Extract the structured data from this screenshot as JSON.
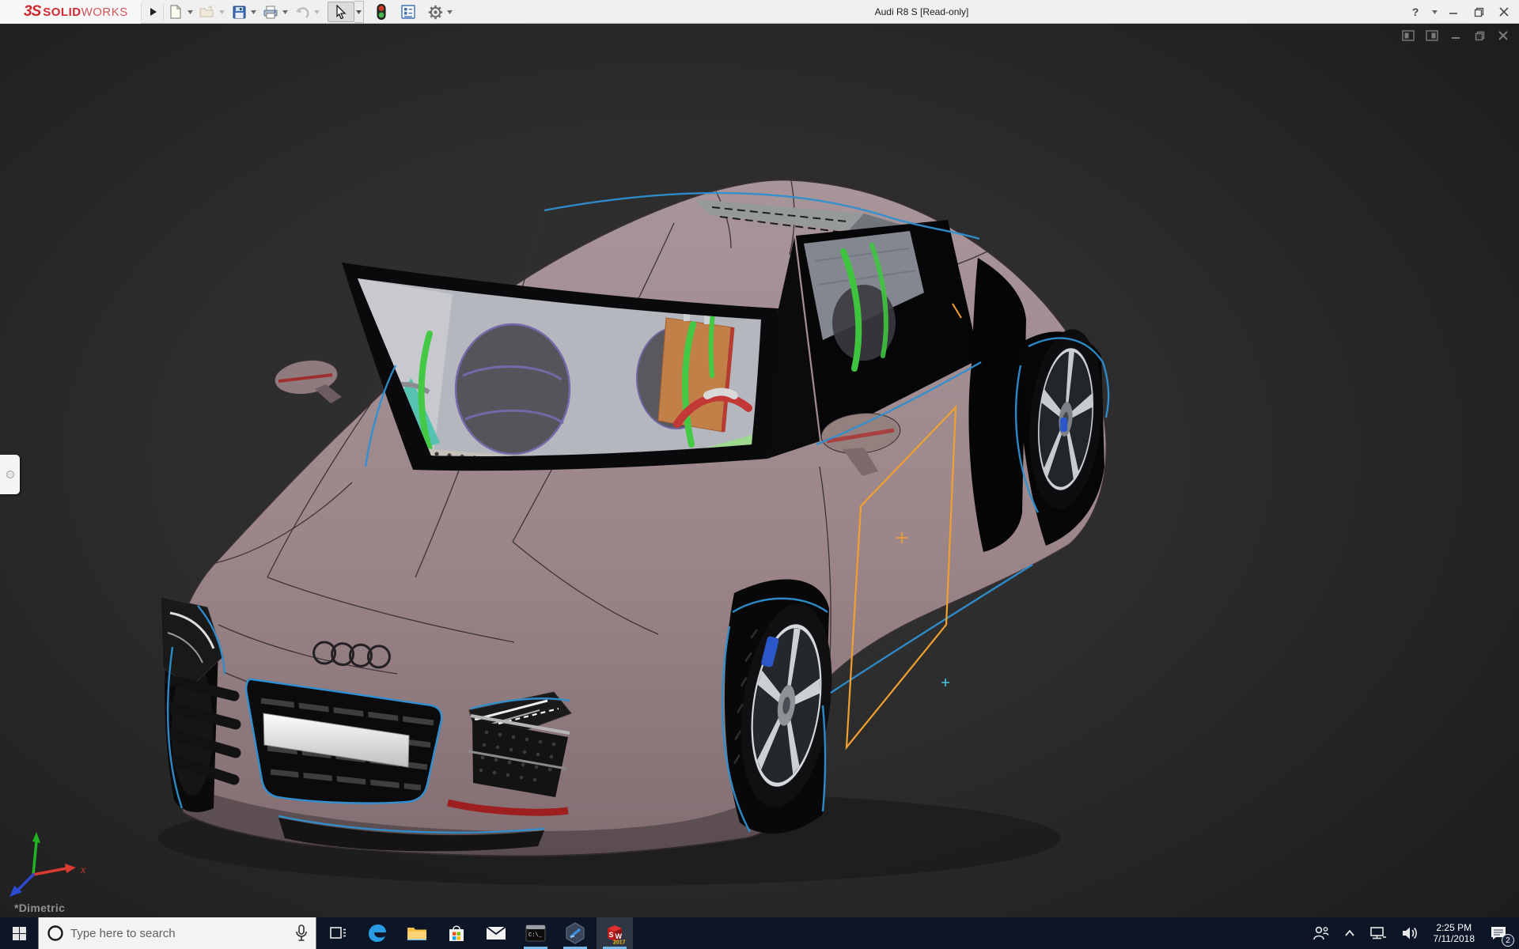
{
  "app": {
    "logo_3s": "3S",
    "logo_solid": "SOLID",
    "logo_works": "WORKS",
    "brand_color": "#cf2a33"
  },
  "titlebar": {
    "title": "Audi R8 S [Read-only]",
    "help_label": "?"
  },
  "toolbar": {
    "buttons": [
      {
        "id": "new",
        "icon": "new-document-icon",
        "dropdown": true,
        "disabled": false
      },
      {
        "id": "open",
        "icon": "open-folder-icon",
        "dropdown": true,
        "disabled": true
      },
      {
        "id": "save",
        "icon": "save-floppy-icon",
        "dropdown": true,
        "disabled": false
      },
      {
        "id": "print",
        "icon": "print-icon",
        "dropdown": true,
        "disabled": false
      },
      {
        "id": "undo",
        "icon": "undo-icon",
        "dropdown": true,
        "disabled": true
      },
      {
        "id": "select",
        "icon": "select-cursor-icon",
        "dropdown": true,
        "active": true
      },
      {
        "id": "rebuild",
        "icon": "rebuild-traffic-light-icon"
      },
      {
        "id": "file-properties",
        "icon": "file-properties-icon"
      },
      {
        "id": "options",
        "icon": "options-gear-icon",
        "dropdown": true
      }
    ]
  },
  "viewport": {
    "background_color": "#2b2b2b",
    "orientation_label": "*Dimetric",
    "triad": {
      "x_label": "x",
      "x_color": "#d93a31",
      "y_color": "#21b321",
      "z_color": "#2b4bd0"
    },
    "doc_controls": [
      "document-window-icon",
      "document-window-icon",
      "minimize-icon",
      "restore-icon",
      "close-icon"
    ],
    "model": {
      "subject": "Audi R8 coupe 3D CAD model, dimetric view",
      "body_color": "#9b8588",
      "wireframe_edge_color": "#3a3136",
      "selected_edge_color": "#2f8fd0",
      "sketch_color": "#f0a030",
      "license_plate_color": "#e8e8e8",
      "brake_caliper_color": "#2b57c8",
      "bumper_stripe_color": "#9e1f1f",
      "interior": {
        "cage_color": "#43c943",
        "seat_color": "#56545a",
        "seat_trim_color": "#7468a8",
        "panel_color": "#c28049",
        "hose_color": "#c23836",
        "teal_panel_color": "#56c2b2",
        "glass_tint": "#b7b9bf"
      }
    }
  },
  "taskbar": {
    "color": "#0d1626",
    "search_placeholder": "Type here to search",
    "apps": [
      "task-view",
      "edge",
      "file-explorer",
      "store",
      "mail",
      "command-prompt",
      "hexagon-app",
      "solidworks-2017"
    ],
    "running_apps": [
      "command-prompt",
      "hexagon-app",
      "solidworks-2017"
    ],
    "cmd_icon_text": "C:\\_",
    "sw_icon": {
      "s": "S",
      "w": "W",
      "year": "2017"
    },
    "tray": {
      "time": "2:25 PM",
      "date": "7/11/2018",
      "notification_badge": "2"
    }
  }
}
